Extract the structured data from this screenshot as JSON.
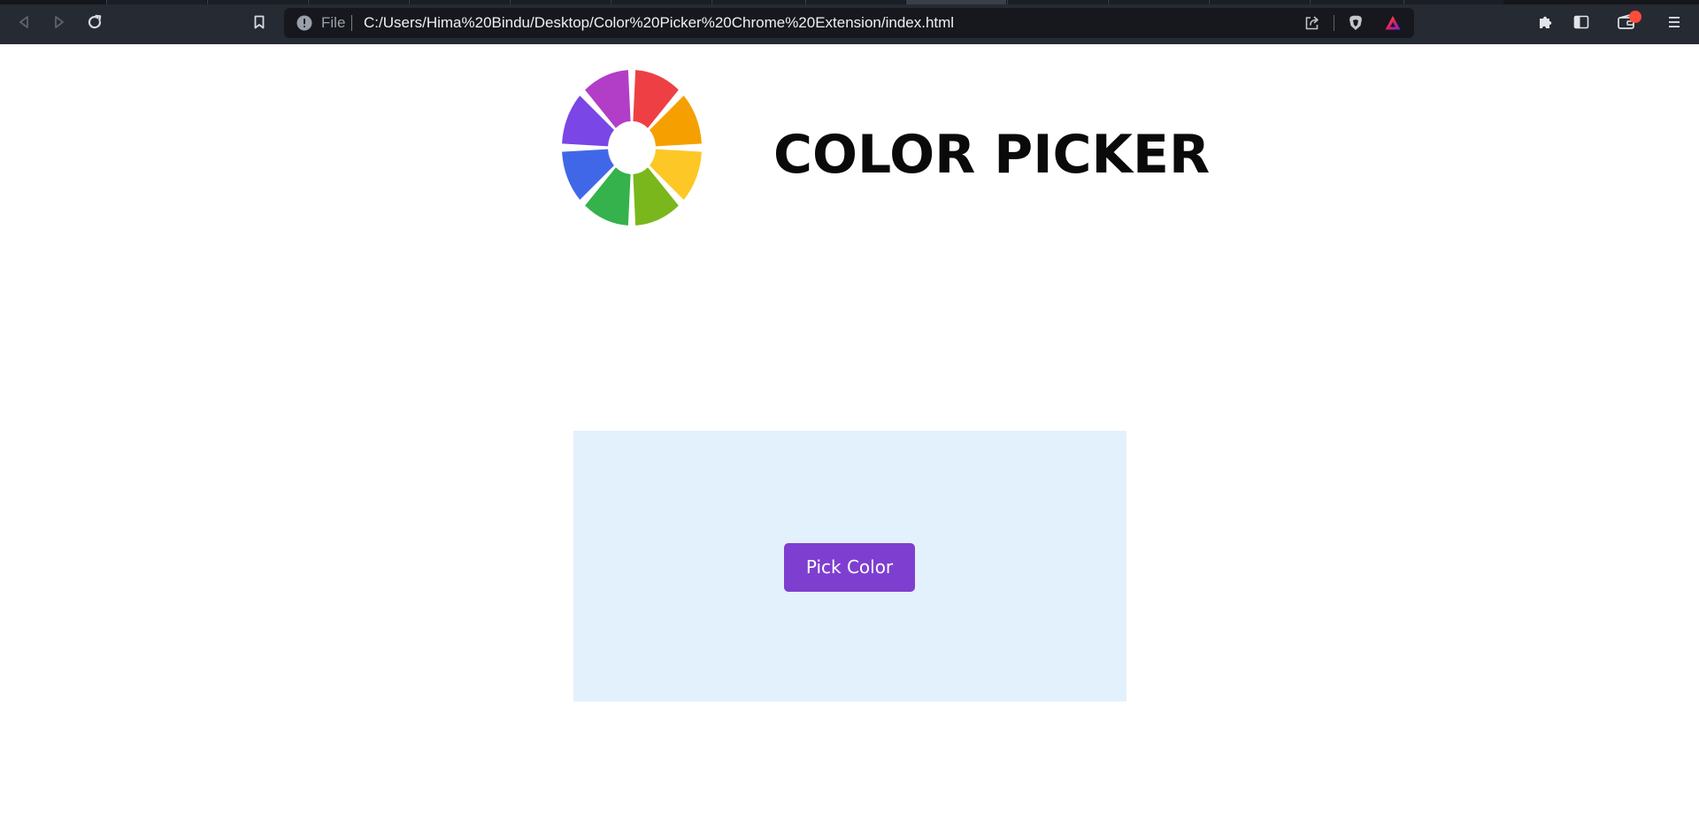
{
  "browser": {
    "address_bar": {
      "scheme_label": "File",
      "url": "C:/Users/Hima%20Bindu/Desktop/Color%20Picker%20Chrome%20Extension/index.html"
    },
    "icons": {
      "back": "back-arrow-icon",
      "forward": "forward-arrow-icon",
      "reload": "reload-icon",
      "bookmark": "bookmark-icon",
      "site_info": "info-icon",
      "share": "share-icon",
      "brave_shields": "brave-shield-icon",
      "brave_rewards": "brave-rewards-icon",
      "extensions": "puzzle-icon",
      "sidebar": "sidebar-icon",
      "wallet": "wallet-icon",
      "menu": "hamburger-menu-icon"
    }
  },
  "page": {
    "title": "COLOR PICKER",
    "logo_colors": [
      "#ee4044",
      "#f5a000",
      "#fdc725",
      "#7ab71c",
      "#35b24b",
      "#4167e9",
      "#7a46e6",
      "#b23ec7"
    ],
    "panel_background": "#e3f1fc",
    "pick_button": {
      "label": "Pick Color",
      "color": "#7e3fd0"
    }
  }
}
